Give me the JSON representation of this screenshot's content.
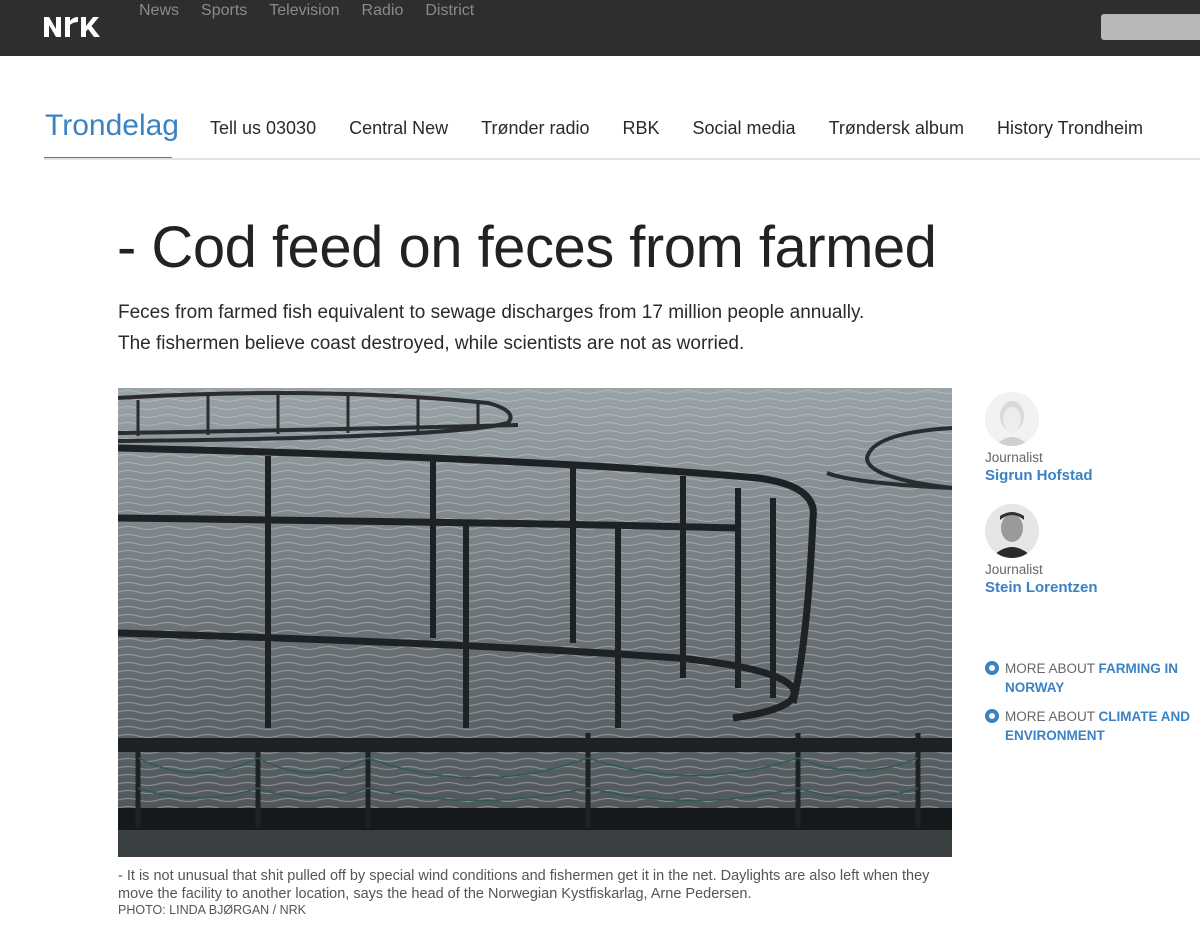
{
  "topbar": {
    "logo": "NRK",
    "nav": [
      "News",
      "Sports",
      "Television",
      "Radio",
      "District"
    ]
  },
  "section": {
    "title": "Trondelag",
    "items": [
      "Tell us 03030",
      "Central New",
      "Trønder radio",
      "RBK",
      "Social media",
      "Trøndersk album",
      "History Trondheim"
    ]
  },
  "article": {
    "headline": "- Cod feed on feces from farmed",
    "lead": "Feces from farmed fish equivalent to sewage discharges from 17 million people annually. The fishermen believe coast destroyed, while scientists are not as worried.",
    "caption": "- It is not unusual that shit pulled off by special wind conditions and fishermen get it in the net. Daylights are also left when they move the facility to another location, says the head of the Norwegian Kystfiskarlag, Arne Pedersen.",
    "credit": "PHOTO: LINDA BJØRGAN / NRK"
  },
  "authors": [
    {
      "role": "Journalist",
      "name": "Sigrun Hofstad"
    },
    {
      "role": "Journalist",
      "name": "Stein Lorentzen"
    }
  ],
  "more_about": [
    {
      "prefix": "MORE ABOUT",
      "topic": "FARMING IN NORWAY"
    },
    {
      "prefix": "MORE ABOUT",
      "topic": "CLIMATE AND ENVIRONMENT"
    }
  ],
  "colors": {
    "accent": "#3b82c4",
    "topbar": "#2e2e2e"
  }
}
